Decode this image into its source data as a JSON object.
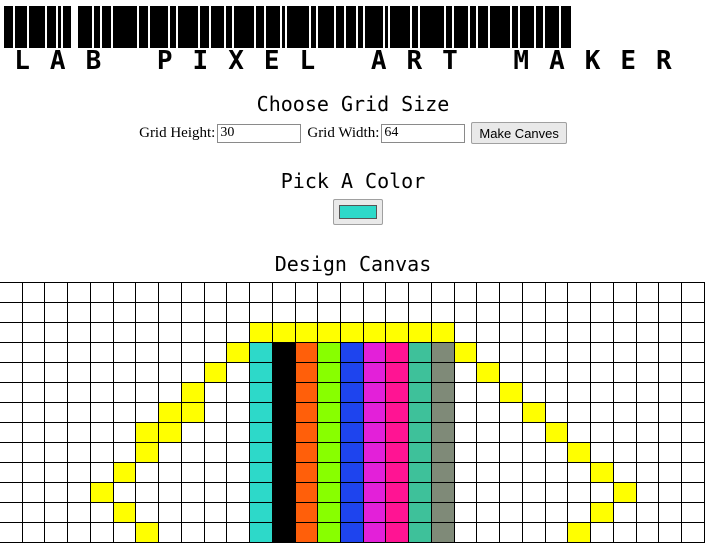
{
  "app": {
    "title": "LAB PIXEL ART MAKER"
  },
  "grid_size": {
    "heading": "Choose Grid Size",
    "height_label": "Grid Height:",
    "height_value": "30",
    "width_label": "Grid Width:",
    "width_value": "64",
    "submit_label": "Make Canves"
  },
  "color": {
    "heading": "Pick A Color",
    "current": "#2dd9c9"
  },
  "canvas": {
    "heading": "Design Canvas",
    "palette": {
      "Y": "#ffff00",
      "C": "#2dd9c9",
      "K": "#000000",
      "O": "#ff5f0a",
      "G": "#88ff00",
      "B": "#1e44ee",
      "M": "#e320d9",
      "P": "#ff1493",
      "T": "#3ec19a",
      "S": "#7f8a78"
    },
    "painted_rows": [
      {
        "cells": {}
      },
      {
        "cells": {}
      },
      {
        "cells": {
          "11": "Y",
          "12": "Y",
          "13": "Y",
          "14": "Y",
          "15": "Y",
          "16": "Y",
          "17": "Y",
          "18": "Y",
          "19": "Y"
        }
      },
      {
        "cells": {
          "10": "Y",
          "11": "C",
          "12": "K",
          "13": "O",
          "14": "G",
          "15": "B",
          "16": "M",
          "17": "P",
          "18": "T",
          "19": "S",
          "20": "Y"
        }
      },
      {
        "cells": {
          "9": "Y",
          "11": "C",
          "12": "K",
          "13": "O",
          "14": "G",
          "15": "B",
          "16": "M",
          "17": "P",
          "18": "T",
          "19": "S",
          "21": "Y"
        }
      },
      {
        "cells": {
          "8": "Y",
          "11": "C",
          "12": "K",
          "13": "O",
          "14": "G",
          "15": "B",
          "16": "M",
          "17": "P",
          "18": "T",
          "19": "S",
          "22": "Y"
        }
      },
      {
        "cells": {
          "7": "Y",
          "8": "Y",
          "11": "C",
          "12": "K",
          "13": "O",
          "14": "G",
          "15": "B",
          "16": "M",
          "17": "P",
          "18": "T",
          "19": "S",
          "23": "Y"
        }
      },
      {
        "cells": {
          "6": "Y",
          "7": "Y",
          "11": "C",
          "12": "K",
          "13": "O",
          "14": "G",
          "15": "B",
          "16": "M",
          "17": "P",
          "18": "T",
          "19": "S",
          "24": "Y"
        }
      },
      {
        "cells": {
          "6": "Y",
          "11": "C",
          "12": "K",
          "13": "O",
          "14": "G",
          "15": "B",
          "16": "M",
          "17": "P",
          "18": "T",
          "19": "S",
          "25": "Y"
        }
      },
      {
        "cells": {
          "5": "Y",
          "11": "C",
          "12": "K",
          "13": "O",
          "14": "G",
          "15": "B",
          "16": "M",
          "17": "P",
          "18": "T",
          "19": "S",
          "26": "Y"
        }
      },
      {
        "cells": {
          "4": "Y",
          "11": "C",
          "12": "K",
          "13": "O",
          "14": "G",
          "15": "B",
          "16": "M",
          "17": "P",
          "18": "T",
          "19": "S",
          "27": "Y"
        }
      },
      {
        "cells": {
          "5": "Y",
          "11": "C",
          "12": "K",
          "13": "O",
          "14": "G",
          "15": "B",
          "16": "M",
          "17": "P",
          "18": "T",
          "19": "S",
          "26": "Y"
        }
      },
      {
        "cells": {
          "6": "Y",
          "11": "C",
          "12": "K",
          "13": "O",
          "14": "G",
          "15": "B",
          "16": "M",
          "17": "P",
          "18": "T",
          "19": "S",
          "25": "Y"
        }
      }
    ]
  }
}
